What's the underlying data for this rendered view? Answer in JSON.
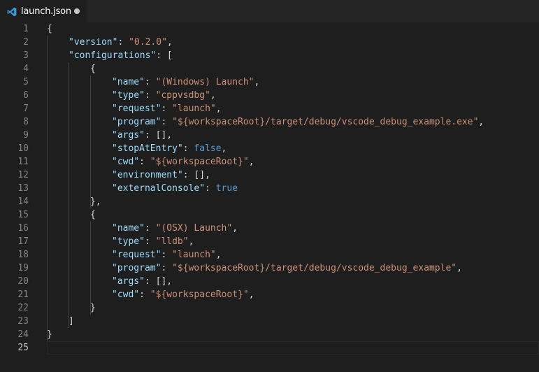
{
  "tab": {
    "title": "launch.json",
    "icon": "vscode-icon",
    "dirty": true
  },
  "colors": {
    "key": "#9cdcfe",
    "string": "#ce9178",
    "boolean": "#569cd6",
    "punctuation": "#d4d4d4",
    "line_number": "#858585",
    "background": "#1e1e1e"
  },
  "editor": {
    "active_line": 25,
    "lines": [
      {
        "n": "1",
        "tokens": [
          {
            "t": "p",
            "v": "{"
          }
        ],
        "indent": 0
      },
      {
        "n": "2",
        "tokens": [
          {
            "t": "k",
            "v": "\"version\""
          },
          {
            "t": "p",
            "v": ": "
          },
          {
            "t": "s",
            "v": "\"0.2.0\""
          },
          {
            "t": "p",
            "v": ","
          }
        ],
        "indent": 1
      },
      {
        "n": "3",
        "tokens": [
          {
            "t": "k",
            "v": "\"configurations\""
          },
          {
            "t": "p",
            "v": ": ["
          }
        ],
        "indent": 1
      },
      {
        "n": "4",
        "tokens": [
          {
            "t": "p",
            "v": "{"
          }
        ],
        "indent": 2
      },
      {
        "n": "5",
        "tokens": [
          {
            "t": "k",
            "v": "\"name\""
          },
          {
            "t": "p",
            "v": ": "
          },
          {
            "t": "s",
            "v": "\"(Windows) Launch\""
          },
          {
            "t": "p",
            "v": ","
          }
        ],
        "indent": 3
      },
      {
        "n": "6",
        "tokens": [
          {
            "t": "k",
            "v": "\"type\""
          },
          {
            "t": "p",
            "v": ": "
          },
          {
            "t": "s",
            "v": "\"cppvsdbg\""
          },
          {
            "t": "p",
            "v": ","
          }
        ],
        "indent": 3
      },
      {
        "n": "7",
        "tokens": [
          {
            "t": "k",
            "v": "\"request\""
          },
          {
            "t": "p",
            "v": ": "
          },
          {
            "t": "s",
            "v": "\"launch\""
          },
          {
            "t": "p",
            "v": ","
          }
        ],
        "indent": 3
      },
      {
        "n": "8",
        "tokens": [
          {
            "t": "k",
            "v": "\"program\""
          },
          {
            "t": "p",
            "v": ": "
          },
          {
            "t": "s",
            "v": "\"${workspaceRoot}/target/debug/vscode_debug_example.exe\""
          },
          {
            "t": "p",
            "v": ","
          }
        ],
        "indent": 3
      },
      {
        "n": "9",
        "tokens": [
          {
            "t": "k",
            "v": "\"args\""
          },
          {
            "t": "p",
            "v": ": [],"
          }
        ],
        "indent": 3
      },
      {
        "n": "10",
        "tokens": [
          {
            "t": "k",
            "v": "\"stopAtEntry\""
          },
          {
            "t": "p",
            "v": ": "
          },
          {
            "t": "b",
            "v": "false"
          },
          {
            "t": "p",
            "v": ","
          }
        ],
        "indent": 3
      },
      {
        "n": "11",
        "tokens": [
          {
            "t": "k",
            "v": "\"cwd\""
          },
          {
            "t": "p",
            "v": ": "
          },
          {
            "t": "s",
            "v": "\"${workspaceRoot}\""
          },
          {
            "t": "p",
            "v": ","
          }
        ],
        "indent": 3
      },
      {
        "n": "12",
        "tokens": [
          {
            "t": "k",
            "v": "\"environment\""
          },
          {
            "t": "p",
            "v": ": [],"
          }
        ],
        "indent": 3
      },
      {
        "n": "13",
        "tokens": [
          {
            "t": "k",
            "v": "\"externalConsole\""
          },
          {
            "t": "p",
            "v": ": "
          },
          {
            "t": "b",
            "v": "true"
          }
        ],
        "indent": 3
      },
      {
        "n": "14",
        "tokens": [
          {
            "t": "p",
            "v": "},"
          }
        ],
        "indent": 2
      },
      {
        "n": "15",
        "tokens": [
          {
            "t": "p",
            "v": "{"
          }
        ],
        "indent": 2
      },
      {
        "n": "16",
        "tokens": [
          {
            "t": "k",
            "v": "\"name\""
          },
          {
            "t": "p",
            "v": ": "
          },
          {
            "t": "s",
            "v": "\"(OSX) Launch\""
          },
          {
            "t": "p",
            "v": ","
          }
        ],
        "indent": 3
      },
      {
        "n": "17",
        "tokens": [
          {
            "t": "k",
            "v": "\"type\""
          },
          {
            "t": "p",
            "v": ": "
          },
          {
            "t": "s",
            "v": "\"lldb\""
          },
          {
            "t": "p",
            "v": ","
          }
        ],
        "indent": 3
      },
      {
        "n": "18",
        "tokens": [
          {
            "t": "k",
            "v": "\"request\""
          },
          {
            "t": "p",
            "v": ": "
          },
          {
            "t": "s",
            "v": "\"launch\""
          },
          {
            "t": "p",
            "v": ","
          }
        ],
        "indent": 3
      },
      {
        "n": "19",
        "tokens": [
          {
            "t": "k",
            "v": "\"program\""
          },
          {
            "t": "p",
            "v": ": "
          },
          {
            "t": "s",
            "v": "\"${workspaceRoot}/target/debug/vscode_debug_example\""
          },
          {
            "t": "p",
            "v": ","
          }
        ],
        "indent": 3
      },
      {
        "n": "20",
        "tokens": [
          {
            "t": "k",
            "v": "\"args\""
          },
          {
            "t": "p",
            "v": ": [],"
          }
        ],
        "indent": 3
      },
      {
        "n": "21",
        "tokens": [
          {
            "t": "k",
            "v": "\"cwd\""
          },
          {
            "t": "p",
            "v": ": "
          },
          {
            "t": "s",
            "v": "\"${workspaceRoot}\""
          },
          {
            "t": "p",
            "v": ","
          }
        ],
        "indent": 3
      },
      {
        "n": "22",
        "tokens": [
          {
            "t": "p",
            "v": "}"
          }
        ],
        "indent": 2
      },
      {
        "n": "23",
        "tokens": [
          {
            "t": "p",
            "v": "]"
          }
        ],
        "indent": 1
      },
      {
        "n": "24",
        "tokens": [
          {
            "t": "p",
            "v": "}"
          }
        ],
        "indent": 0
      },
      {
        "n": "25",
        "tokens": [],
        "indent": 0
      }
    ]
  }
}
